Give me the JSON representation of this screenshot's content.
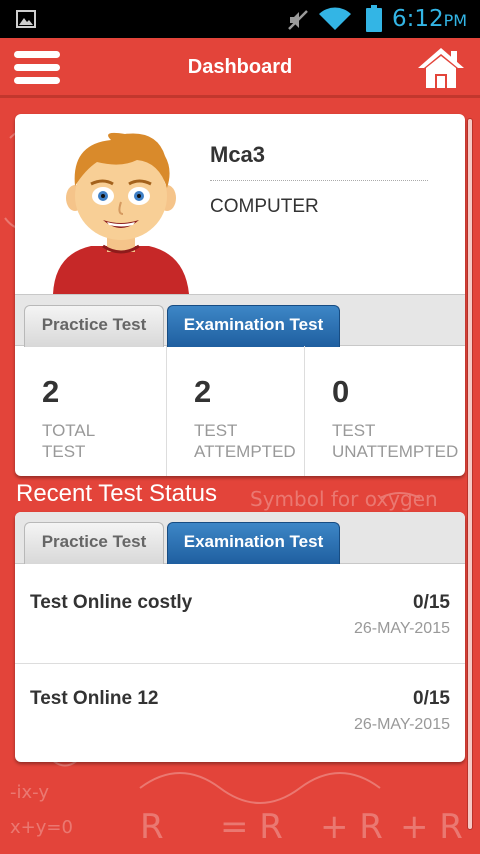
{
  "status_bar": {
    "time": "6:12",
    "ampm": "PM",
    "icons": [
      "image-notification-icon",
      "mute-icon",
      "wifi-icon",
      "battery-icon"
    ],
    "accent_color": "#33b5e5"
  },
  "app_bar": {
    "title": "Dashboard",
    "menu_icon": "menu-icon",
    "home_icon": "home-icon",
    "background": "#e3443a"
  },
  "profile": {
    "name": "Mca3",
    "department": "COMPUTER",
    "avatar": "cartoon-boy-avatar"
  },
  "summary_tabs": [
    {
      "label": "Practice Test",
      "active": false
    },
    {
      "label": "Examination Test",
      "active": true
    }
  ],
  "stats": [
    {
      "value": "2",
      "label_line1": "TOTAL",
      "label_line2": "TEST"
    },
    {
      "value": "2",
      "label_line1": "TEST",
      "label_line2": "ATTEMPTED"
    },
    {
      "value": "0",
      "label_line1": "TEST",
      "label_line2": "UNATTEMPTED"
    }
  ],
  "recent": {
    "title": "Recent Test Status",
    "tabs": [
      {
        "label": "Practice Test",
        "active": false
      },
      {
        "label": "Examination Test",
        "active": true
      }
    ],
    "tests": [
      {
        "name": "Test Online costly",
        "score": "0/15",
        "date": "26-MAY-2015"
      },
      {
        "name": "Test Online 12",
        "score": "0/15",
        "date": "26-MAY-2015"
      }
    ]
  },
  "colors": {
    "active_tab": "#2c6fb0",
    "card": "#ffffff"
  }
}
